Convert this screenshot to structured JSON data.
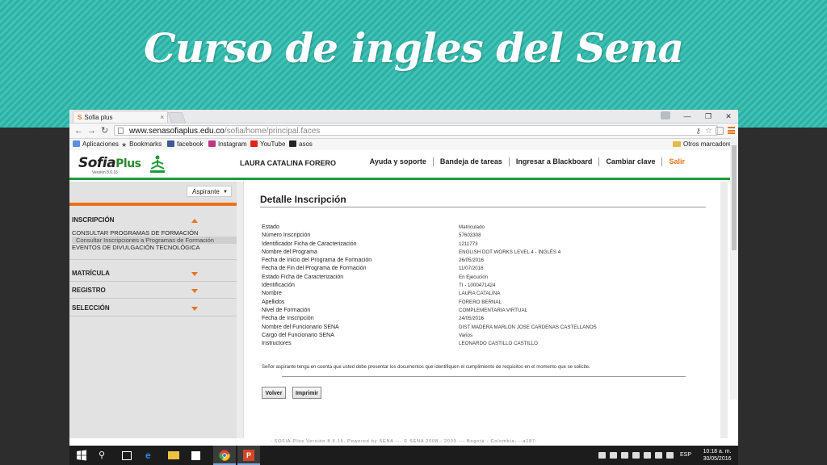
{
  "slide": {
    "title": "Curso de ingles del Sena"
  },
  "browser": {
    "tab_title": "Sofia plus",
    "url_domain": "www.senasofiaplus.edu.co",
    "url_path": "/sofia/home/principal.faces",
    "bookmarks": [
      "Aplicaciones",
      "Bookmarks",
      "facebook",
      "Instagram",
      "YouTube",
      "asos"
    ],
    "other_bookmarks": "Otros marcadores"
  },
  "site": {
    "logo_text": "Sofia",
    "logo_plus": "Plus",
    "version_small": "Versión 8.6.16",
    "user": "LAURA CATALINA FORERO",
    "nav": [
      "Ayuda y soporte",
      "Bandeja de tareas",
      "Ingresar a Blackboard",
      "Cambiar clave",
      "Salir"
    ],
    "accent_orange": "#e8731a",
    "accent_green": "#1e9b39"
  },
  "sidebar": {
    "role": "Aspirante",
    "sections": {
      "inscripcion": "INSCRIPCIÓN",
      "matricula": "MATRÍCULA",
      "registro": "REGISTRO",
      "seleccion": "SELECCIÓN"
    },
    "inscripcion_items": [
      "CONSULTAR PROGRAMAS DE FORMACIÓN",
      "Consultar Inscripciones a Programas de Formación",
      "EVENTOS DE DIVULGACIÓN TECNOLÓGICA"
    ]
  },
  "detalle": {
    "title": "Detalle Inscripción",
    "rows": [
      {
        "label": "Estado",
        "value": "Matriculado"
      },
      {
        "label": "Número Inscripción",
        "value": "57603308"
      },
      {
        "label": "Identificador Ficha de Caracterización",
        "value": "1211773"
      },
      {
        "label": "Nombre del Programa",
        "value": "ENGLISH DOT WORKS LEVEL 4 - INGLÉS 4"
      },
      {
        "label": "Fecha de Inicio del Programa de Formación",
        "value": "26/05/2016"
      },
      {
        "label": "Fecha de Fin del Programa de Formación",
        "value": "11/07/2016"
      },
      {
        "label": "Estado Ficha de Caracterización",
        "value": "En Ejecución"
      },
      {
        "label": "Identificación",
        "value": "TI - 1000471424"
      },
      {
        "label": "Nombre",
        "value": "LAURA CATALINA"
      },
      {
        "label": "Apellidos",
        "value": "FORERO BERNAL"
      },
      {
        "label": "Nivel de Formación",
        "value": "COMPLEMENTARIA VIRTUAL"
      },
      {
        "label": "Fecha de Inscripción",
        "value": "24/05/2016"
      },
      {
        "label": "Nombre del Funcionario SENA",
        "value": "DIST MADERA MARLON JOSE CARDENAS CASTELLANOS"
      },
      {
        "label": "Cargo del Funcionario SENA",
        "value": "Varios"
      },
      {
        "label": "Instructores",
        "value": "LEONARDO CASTILLO CASTILLO"
      }
    ],
    "notice": "Señor aspirante tenga en cuenta que usted debe presentar los documentos que identifiquen el cumplimiento de requisitos en el momento que se solicite.",
    "btn_back": "Volver",
    "btn_print": "Imprimir"
  },
  "footer": "- SOFIA-Plus Versión 8.6.16. Powered by SENA --- © SENA 2008 - 2009 --- Bogotá - Colombia- --a187:",
  "taskbar": {
    "lang": "ESP",
    "time": "10:18 a. m.",
    "date": "30/05/2016"
  }
}
